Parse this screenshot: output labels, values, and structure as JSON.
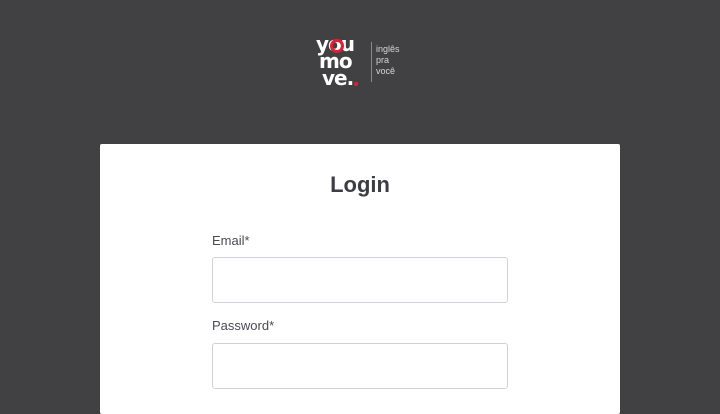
{
  "brand": {
    "logo_lines": [
      "you",
      "mo",
      "ve."
    ],
    "tagline": [
      "inglês",
      "pra",
      "você"
    ],
    "accent_color": "#e41d34"
  },
  "login": {
    "title": "Login",
    "email_label": "Email*",
    "email_value": "",
    "password_label": "Password*",
    "password_value": ""
  }
}
